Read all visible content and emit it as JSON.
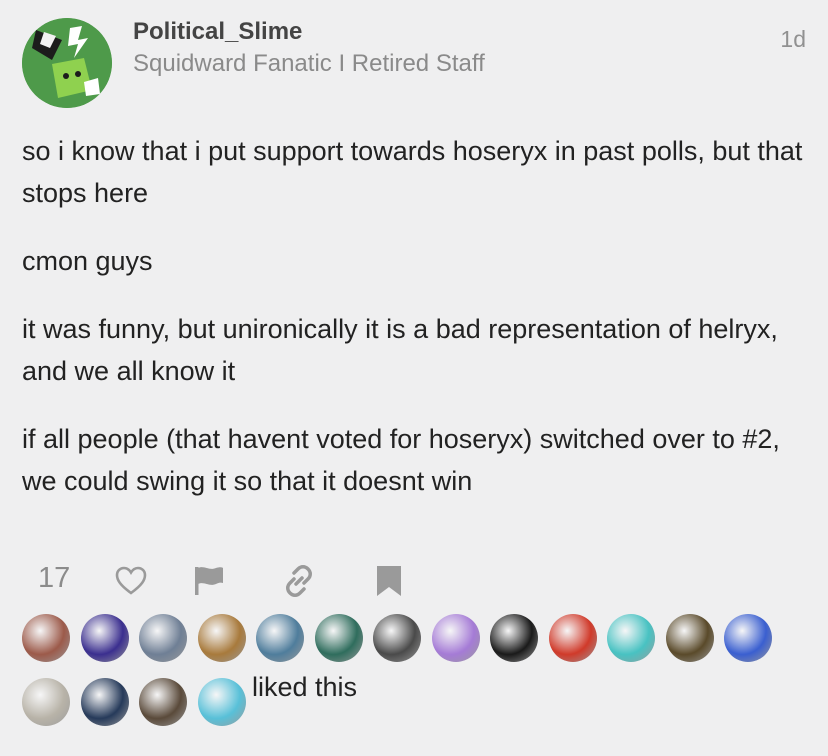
{
  "post": {
    "username": "Political_Slime",
    "user_title": "Squidward Fanatic I Retired Staff",
    "date": "1d",
    "paragraphs": [
      "so i know that i put support towards hoseryx in past polls, but that stops here",
      "cmon guys",
      "it was funny, but unironically it is a bad representation of helryx, and we all know it",
      "if all people (that havent voted for hoseryx) switched over to #2, we could swing it so that it doesnt win"
    ]
  },
  "actions": {
    "like_count": "17",
    "icons": [
      "heart-icon",
      "flag-icon",
      "link-icon",
      "bookmark-icon"
    ]
  },
  "likers": {
    "avatars": [
      {
        "name": "liker-avatar-1",
        "color": "#9c5a4a"
      },
      {
        "name": "liker-avatar-2",
        "color": "#3b2f8f"
      },
      {
        "name": "liker-avatar-3",
        "color": "#6f7f95"
      },
      {
        "name": "liker-avatar-4",
        "color": "#a87a3c"
      },
      {
        "name": "liker-avatar-5",
        "color": "#4f7d9c"
      },
      {
        "name": "liker-avatar-6",
        "color": "#2f6d5d"
      },
      {
        "name": "liker-avatar-7",
        "color": "#4a4a4a"
      },
      {
        "name": "liker-avatar-8",
        "color": "#a57bd6"
      },
      {
        "name": "liker-avatar-9",
        "color": "#1a1a1a"
      },
      {
        "name": "liker-avatar-10",
        "color": "#d03a2a"
      },
      {
        "name": "liker-avatar-11",
        "color": "#48c2c2"
      },
      {
        "name": "liker-avatar-12",
        "color": "#5a4a2a"
      },
      {
        "name": "liker-avatar-13",
        "color": "#3a5fd0"
      },
      {
        "name": "liker-avatar-14",
        "color": "#b8b3a8"
      },
      {
        "name": "liker-avatar-15",
        "color": "#263a5a"
      },
      {
        "name": "liker-avatar-16",
        "color": "#5a4a3a"
      },
      {
        "name": "liker-avatar-17",
        "color": "#58c0d8"
      }
    ],
    "suffix": "liked this"
  }
}
